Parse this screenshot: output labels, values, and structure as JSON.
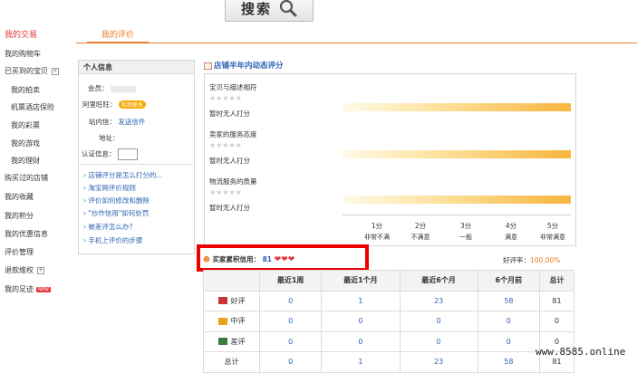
{
  "search": {
    "label": "搜索",
    "icon": "magnifier-icon"
  },
  "nav": {
    "items": [
      {
        "label": "我的交易",
        "active": true,
        "sub": false
      },
      {
        "label": "我的购物车",
        "sub": false
      },
      {
        "label": "已买到的宝贝",
        "sub": false,
        "toggle": "+"
      },
      {
        "label": "我的拍卖",
        "sub": true
      },
      {
        "label": "机票酒店保险",
        "sub": true
      },
      {
        "label": "我的彩票",
        "sub": true
      },
      {
        "label": "我的游戏",
        "sub": true
      },
      {
        "label": "我的理财",
        "sub": true
      },
      {
        "label": "购买过的店铺",
        "sub": false
      },
      {
        "label": "我的收藏",
        "sub": false
      },
      {
        "label": "我的积分",
        "sub": false
      },
      {
        "label": "我的优惠信息",
        "sub": false
      },
      {
        "label": "评价管理",
        "sub": false
      },
      {
        "label": "退款维权",
        "sub": false,
        "toggle": "+"
      },
      {
        "label": "我的足迹",
        "sub": false,
        "badge": "NEW"
      }
    ]
  },
  "tab": {
    "label": "我的评价"
  },
  "info": {
    "title": "个人信息",
    "member_label": "会员：",
    "wangwang_label": "阿里旺旺：",
    "wangwang_status": "和我联系",
    "station_label": "站内信：",
    "station_link": "发送信件",
    "address_label": "地址：",
    "auth_label": "认证信息：",
    "faq": [
      "店铺评分是怎么打分的...",
      "淘宝网评价规则",
      "评价如何修改和删除",
      "\"炒作信用\"如何处罚",
      "被差评怎么办?",
      "手机上评价的步骤"
    ]
  },
  "rating": {
    "title": "店铺半年内动态评分",
    "items": [
      {
        "label": "宝贝与描述相符",
        "status": "暂时无人打分"
      },
      {
        "label": "卖家的服务态度",
        "status": "暂时无人打分"
      },
      {
        "label": "物流服务的质量",
        "status": "暂时无人打分"
      }
    ],
    "scale": [
      {
        "num": "1分",
        "txt": "非常不满"
      },
      {
        "num": "2分",
        "txt": "不满意"
      },
      {
        "num": "3分",
        "txt": "一般"
      },
      {
        "num": "4分",
        "txt": "满意"
      },
      {
        "num": "5分",
        "txt": "非常满意"
      }
    ]
  },
  "credit": {
    "label": "买家累积信用：",
    "value": "81",
    "hearts": "❤❤❤",
    "good_rate_label": "好评率：",
    "good_rate_value": "100.00%"
  },
  "table": {
    "headers": [
      "",
      "最近1周",
      "最近1个月",
      "最近6个月",
      "6个月前",
      "总计"
    ],
    "rows": [
      {
        "label": "好评",
        "values": [
          "0",
          "1",
          "23",
          "58",
          "81"
        ]
      },
      {
        "label": "中评",
        "values": [
          "0",
          "0",
          "0",
          "0",
          "0"
        ]
      },
      {
        "label": "差评",
        "values": [
          "0",
          "0",
          "0",
          "0",
          "0"
        ]
      },
      {
        "label": "总计",
        "values": [
          "0",
          "1",
          "23",
          "58",
          "81"
        ]
      }
    ]
  },
  "watermark": "www.8585.online",
  "colors": {
    "accent": "#e87c2a",
    "link": "#2d64b3",
    "red": "#e4393c",
    "highlight_border": "#e00"
  }
}
